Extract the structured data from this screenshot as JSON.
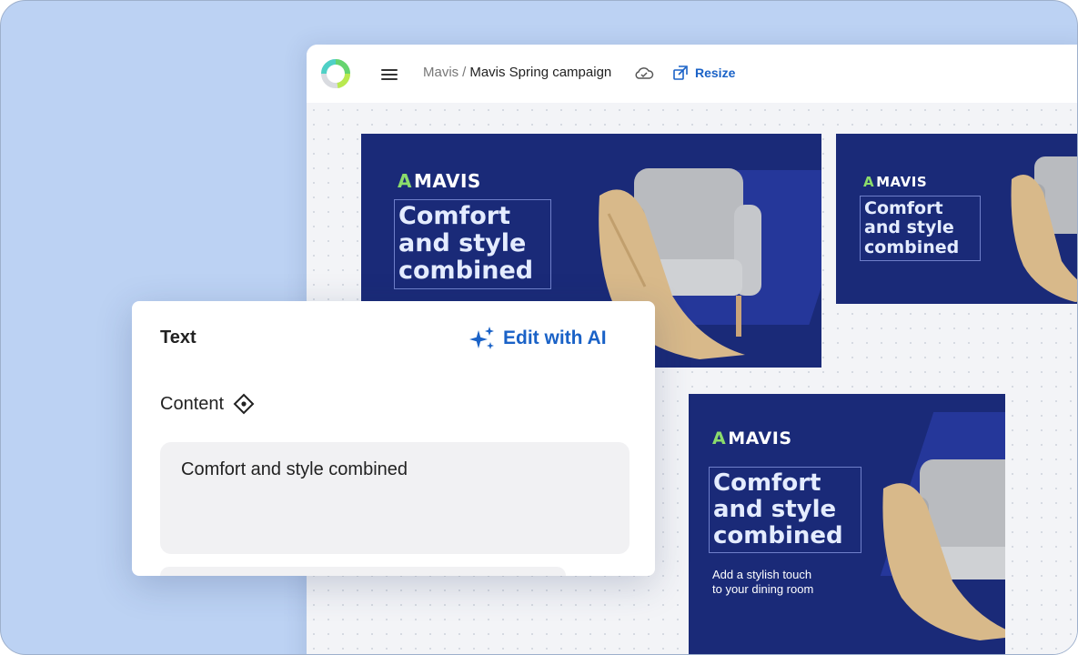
{
  "topbar": {
    "breadcrumb_root": "Mavis",
    "breadcrumb_sep": "/",
    "breadcrumb_current": "Mavis Spring campaign",
    "resize_label": "Resize",
    "icons": [
      "app-logo",
      "menu-icon",
      "cloud-sync-icon",
      "resize-icon"
    ]
  },
  "banners": {
    "brand": "MAVIS",
    "headline_line1": "Comfort",
    "headline_line2": "and style",
    "headline_line3": "combined",
    "headline_alt_line1": "Comfort and style",
    "headline_alt_line2": "combined",
    "subline_1": "Add a stylish touch",
    "subline_2": "to your dining room",
    "colors": {
      "background": "#1a2a78",
      "shape": "#25379a",
      "brand_accent": "#8bdc6b"
    }
  },
  "panel": {
    "title": "Text",
    "edit_ai_label": "Edit with AI",
    "content_label": "Content",
    "content_value": "Comfort and style combined"
  },
  "colors": {
    "accent": "#1a62c7",
    "page_background": "#bcd2f3"
  }
}
